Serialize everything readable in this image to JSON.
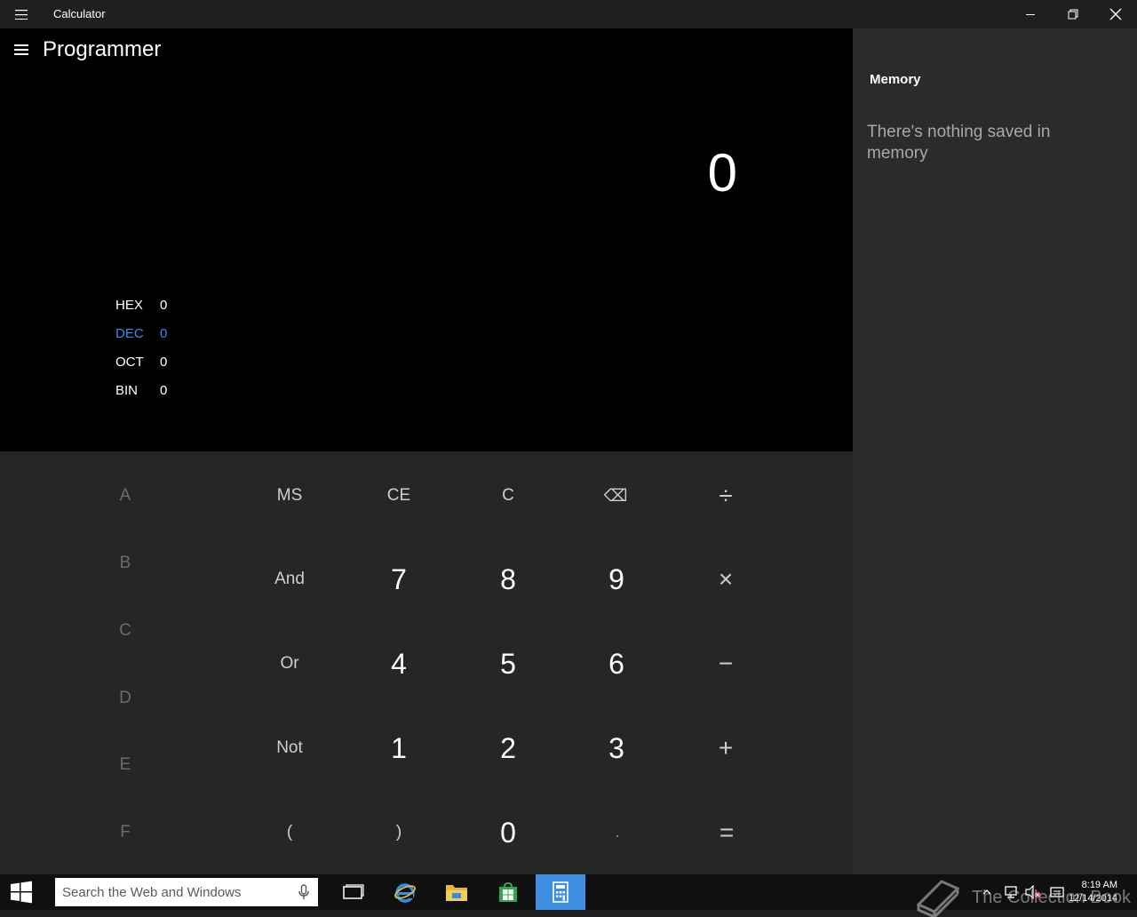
{
  "window": {
    "title": "Calculator",
    "mode_title": "Programmer"
  },
  "display": {
    "value": "0"
  },
  "radix": [
    {
      "label": "HEX",
      "value": "0",
      "active": false
    },
    {
      "label": "DEC",
      "value": "0",
      "active": true
    },
    {
      "label": "OCT",
      "value": "0",
      "active": false
    },
    {
      "label": "BIN",
      "value": "0",
      "active": false
    }
  ],
  "keys": {
    "a": "A",
    "b": "B",
    "c_hex": "C",
    "d": "D",
    "e": "E",
    "f": "F",
    "ms": "MS",
    "ce": "CE",
    "clear": "C",
    "backspace": "⌫",
    "divide": "÷",
    "and": "And",
    "seven": "7",
    "eight": "8",
    "nine": "9",
    "multiply": "×",
    "or": "Or",
    "four": "4",
    "five": "5",
    "six": "6",
    "minus": "−",
    "not": "Not",
    "one": "1",
    "two": "2",
    "three": "3",
    "plus": "+",
    "lparen": "(",
    "rparen": ")",
    "zero": "0",
    "decimal": ".",
    "equals": "="
  },
  "memory": {
    "title": "Memory",
    "empty_text": "There's nothing saved in memory"
  },
  "taskbar": {
    "search_placeholder": "Search the Web and Windows",
    "watermark": "The Collection Book",
    "time": "8:19 AM",
    "date": "12/14/2014"
  },
  "colors": {
    "accent": "#3b8ee8",
    "taskbar_active": "#3d8ee0"
  }
}
